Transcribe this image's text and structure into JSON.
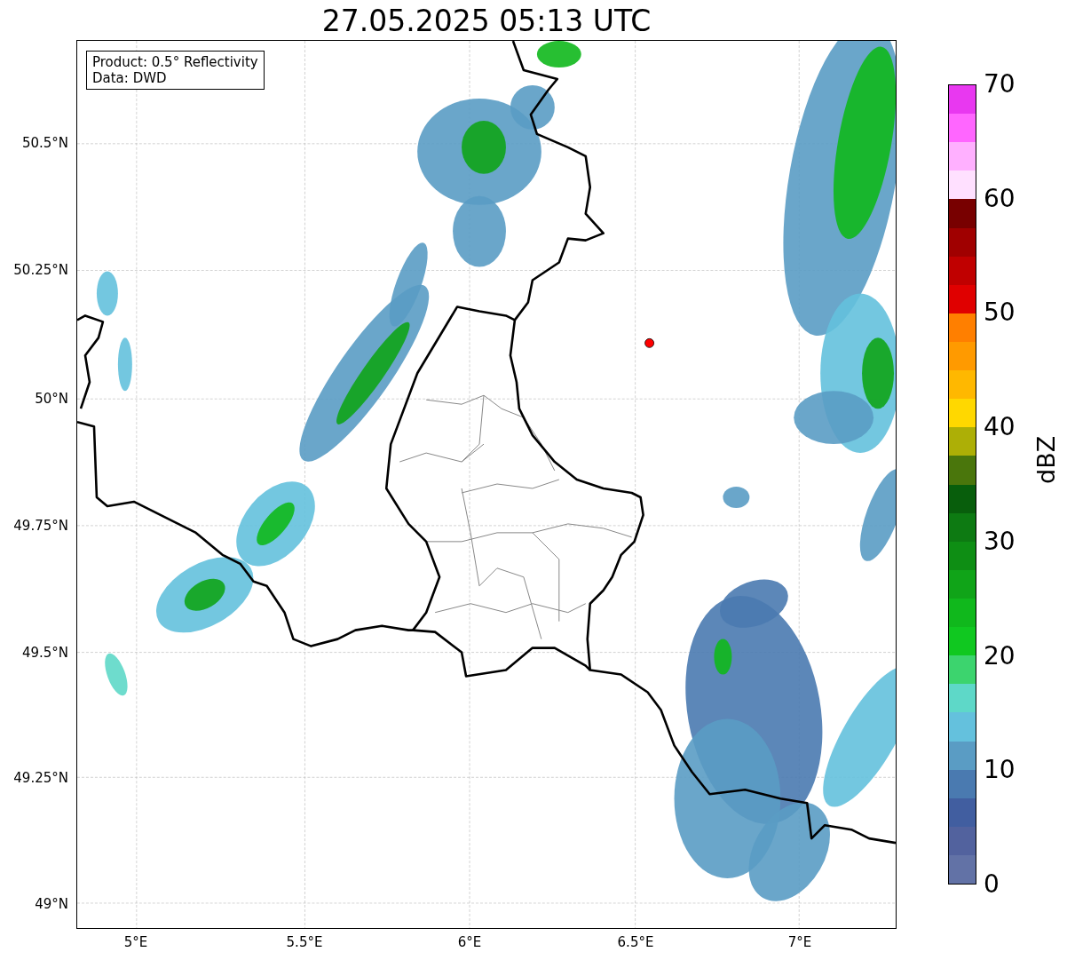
{
  "title": "27.05.2025 05:13 UTC",
  "info_box": [
    "Product: 0.5° Reflectivity",
    "Data: DWD"
  ],
  "y_ticks": [
    "50.5°N",
    "50.25°N",
    "50°N",
    "49.75°N",
    "49.5°N",
    "49.25°N",
    "49°N"
  ],
  "x_ticks": [
    "5°E",
    "5.5°E",
    "6°E",
    "6.5°E",
    "7°E"
  ],
  "colorbar": {
    "label": "dBZ",
    "ticks": [
      "70",
      "60",
      "50",
      "40",
      "30",
      "20",
      "10",
      "0"
    ],
    "bins": [
      {
        "color": "#e838f0"
      },
      {
        "color": "#ff66ff"
      },
      {
        "color": "#ffb0ff"
      },
      {
        "color": "#ffe0ff"
      },
      {
        "color": "#780000"
      },
      {
        "color": "#a00000"
      },
      {
        "color": "#c00000"
      },
      {
        "color": "#e00000"
      },
      {
        "color": "#ff7f00"
      },
      {
        "color": "#ff9a00"
      },
      {
        "color": "#ffb800"
      },
      {
        "color": "#ffd800"
      },
      {
        "color": "#adaf06"
      },
      {
        "color": "#4a760c"
      },
      {
        "color": "#085e0c"
      },
      {
        "color": "#0d7a12"
      },
      {
        "color": "#0e8e14"
      },
      {
        "color": "#10a418"
      },
      {
        "color": "#10b81c"
      },
      {
        "color": "#10c820"
      },
      {
        "color": "#3cd46e"
      },
      {
        "color": "#5ed8c8"
      },
      {
        "color": "#64c1dd"
      },
      {
        "color": "#5a9cc4"
      },
      {
        "color": "#4a7ab0"
      },
      {
        "color": "#415ea0"
      },
      {
        "color": "#52629e"
      },
      {
        "color": "#6272a6"
      }
    ]
  }
}
